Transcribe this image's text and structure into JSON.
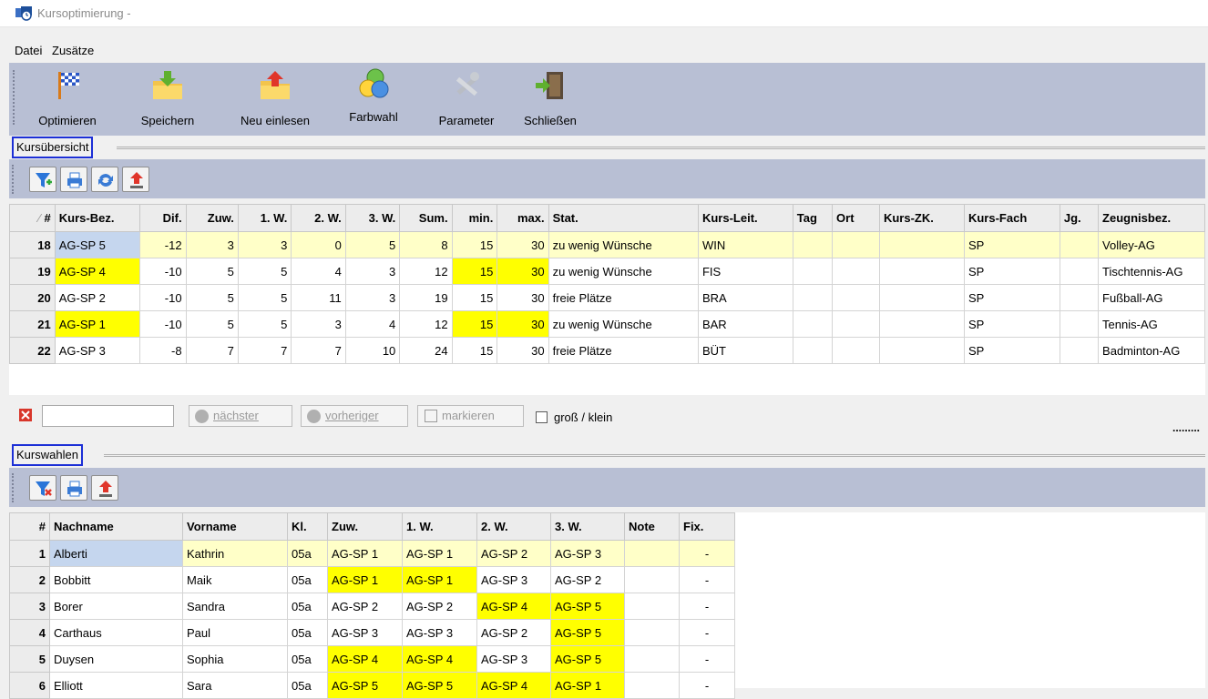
{
  "window": {
    "title": "Kursoptimierung -"
  },
  "menu": [
    "Datei",
    "Zusätze"
  ],
  "toolbar": [
    {
      "label": "Optimieren",
      "icon": "checkered-flag-icon"
    },
    {
      "label": "Speichern",
      "icon": "folder-download-icon"
    },
    {
      "label": "Neu einlesen",
      "icon": "folder-upload-icon"
    },
    {
      "label": "Farbwahl",
      "icon": "color-circles-icon"
    },
    {
      "label": "Parameter",
      "icon": "tools-icon"
    },
    {
      "label": "Schließen",
      "icon": "exit-door-icon"
    }
  ],
  "kursuebersicht": {
    "title": "Kursübersicht",
    "columns": [
      "#",
      "Kurs-Bez.",
      "Dif.",
      "Zuw.",
      "1. W.",
      "2. W.",
      "3. W.",
      "Sum.",
      "min.",
      "max.",
      "Stat.",
      "Kurs-Leit.",
      "Tag",
      "Ort",
      "Kurs-ZK.",
      "Kurs-Fach",
      "Jg.",
      "Zeugnisbez."
    ],
    "rows": [
      [
        "18",
        "AG-SP 5",
        "-12",
        "3",
        "3",
        "0",
        "5",
        "8",
        "15",
        "30",
        "zu wenig Wünsche",
        "WIN",
        "",
        "",
        "",
        "SP",
        "",
        "Volley-AG"
      ],
      [
        "19",
        "AG-SP 4",
        "-10",
        "5",
        "5",
        "4",
        "3",
        "12",
        "15",
        "30",
        "zu wenig Wünsche",
        "FIS",
        "",
        "",
        "",
        "SP",
        "",
        "Tischtennis-AG"
      ],
      [
        "20",
        "AG-SP 2",
        "-10",
        "5",
        "5",
        "11",
        "3",
        "19",
        "15",
        "30",
        "freie Plätze",
        "BRA",
        "",
        "",
        "",
        "SP",
        "",
        "Fußball-AG"
      ],
      [
        "21",
        "AG-SP 1",
        "-10",
        "5",
        "5",
        "3",
        "4",
        "12",
        "15",
        "30",
        "zu wenig Wünsche",
        "BAR",
        "",
        "",
        "",
        "SP",
        "",
        "Tennis-AG"
      ],
      [
        "22",
        "AG-SP 3",
        "-8",
        "7",
        "7",
        "7",
        "10",
        "24",
        "15",
        "30",
        "freie Plätze",
        "BÜT",
        "",
        "",
        "",
        "SP",
        "",
        "Badminton-AG"
      ]
    ]
  },
  "search": {
    "value": "",
    "next": "nächster",
    "prev": "vorheriger",
    "mark": "markieren",
    "case": "groß / klein",
    "dots": "........."
  },
  "kurswahlen": {
    "title": "Kurswahlen",
    "columns": [
      "#",
      "Nachname",
      "Vorname",
      "Kl.",
      "Zuw.",
      "1. W.",
      "2. W.",
      "3. W.",
      "Note",
      "Fix."
    ],
    "rows": [
      [
        "1",
        "Alberti",
        "Kathrin",
        "05a",
        "AG-SP 1",
        "AG-SP 1",
        "AG-SP 2",
        "AG-SP 3",
        "",
        "-"
      ],
      [
        "2",
        "Bobbitt",
        "Maik",
        "05a",
        "AG-SP 1",
        "AG-SP 1",
        "AG-SP 3",
        "AG-SP 2",
        "",
        "-"
      ],
      [
        "3",
        "Borer",
        "Sandra",
        "05a",
        "AG-SP 2",
        "AG-SP 2",
        "AG-SP 4",
        "AG-SP 5",
        "",
        "-"
      ],
      [
        "4",
        "Carthaus",
        "Paul",
        "05a",
        "AG-SP 3",
        "AG-SP 3",
        "AG-SP 2",
        "AG-SP 5",
        "",
        "-"
      ],
      [
        "5",
        "Duysen",
        "Sophia",
        "05a",
        "AG-SP 4",
        "AG-SP 4",
        "AG-SP 3",
        "AG-SP 5",
        "",
        "-"
      ],
      [
        "6",
        "Elliott",
        "Sara",
        "05a",
        "AG-SP 5",
        "AG-SP 5",
        "AG-SP 4",
        "AG-SP 1",
        "",
        "-"
      ]
    ]
  },
  "colors": {
    "highlight": "#ffff00",
    "selected_row": "#ffffc8",
    "selected_cell": "#c5d6ee",
    "toolbar_bg": "#b8bfd4",
    "section_marker": "#1c2fd6"
  }
}
